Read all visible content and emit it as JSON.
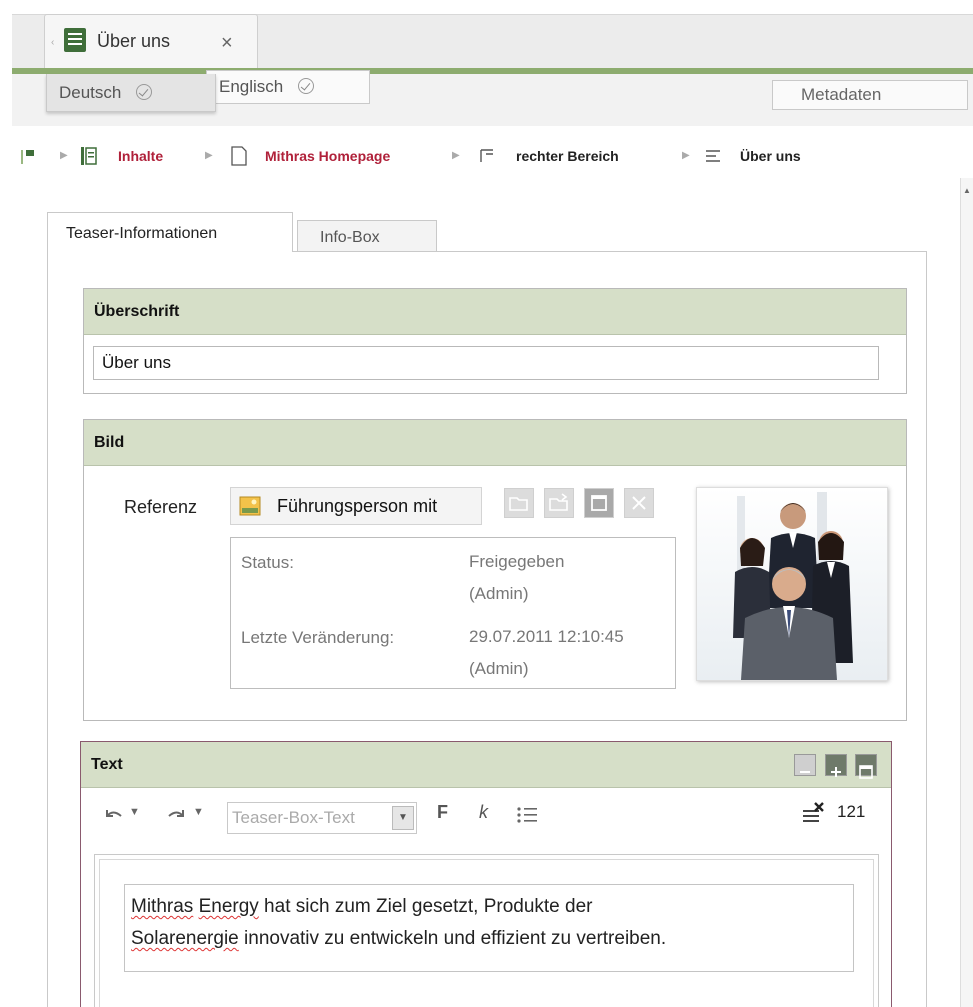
{
  "document_tab": {
    "title": "Über uns",
    "close_glyph": "×",
    "icon": "page-list-icon"
  },
  "languages": {
    "active": "Deutsch",
    "inactive": "Englisch",
    "metadata_button": "Metadaten"
  },
  "breadcrumb": [
    {
      "label": "Inhalte",
      "icon": "pages-icon",
      "link": true
    },
    {
      "label": "Mithras Homepage",
      "icon": "page-icon",
      "link": true
    },
    {
      "label": "rechter Bereich",
      "icon": "section-icon",
      "link": false
    },
    {
      "label": "Über uns",
      "icon": "list-icon",
      "link": false
    }
  ],
  "tabs": {
    "active": "Teaser-Informationen",
    "inactive": "Info-Box"
  },
  "heading_section": {
    "title": "Überschrift",
    "value": "Über uns"
  },
  "image_section": {
    "title": "Bild",
    "reference_label": "Referenz",
    "reference_value": "Führungsperson mit",
    "status_label": "Status:",
    "status_value_1": "Freigegeben",
    "status_value_2": "(Admin)",
    "changed_label": "Letzte Veränderung:",
    "changed_value_1": "29.07.2011 12:10:45",
    "changed_value_2": "(Admin)"
  },
  "text_section": {
    "title": "Text",
    "style_select": "Teaser-Box-Text",
    "bold_label": "F",
    "italic_label": "k",
    "char_count": "121",
    "content": {
      "w1": "Mithras",
      "w2": " ",
      "w3": "Energy",
      "w4": " hat sich zum Ziel gesetzt, Produkte der",
      "w5": "Solarenergie",
      "w6": " innovativ zu entwickeln und effizient zu vertreiben."
    }
  },
  "colors": {
    "accent_green": "#8dac6f",
    "section_header": "#d6dfc8",
    "link_red": "#b0213a"
  }
}
